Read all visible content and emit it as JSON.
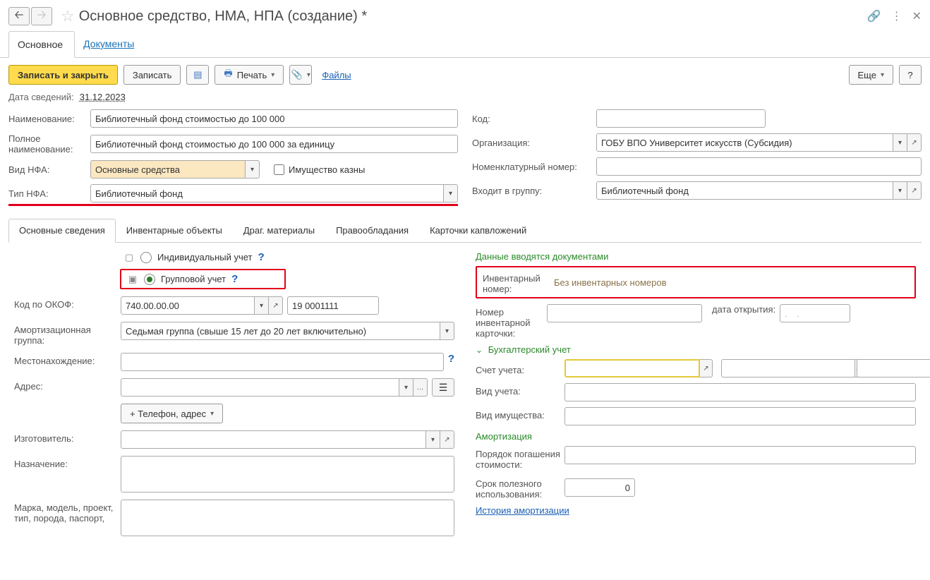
{
  "header": {
    "title": "Основное средство, НМА, НПА (создание) *"
  },
  "main_tabs": [
    {
      "label": "Основное"
    },
    {
      "label": "Документы"
    }
  ],
  "toolbar": {
    "save_close": "Записать и закрыть",
    "save": "Записать",
    "print": "Печать",
    "files": "Файлы",
    "more": "Еще",
    "help": "?"
  },
  "date_row": {
    "label": "Дата сведений:",
    "value": "31.12.2023"
  },
  "fields_left": {
    "name_label": "Наименование:",
    "name_value": "Библиотечный фонд стоимостью до 100 000",
    "fullname_label": "Полное наименование:",
    "fullname_value": "Библиотечный фонд стоимостью до 100 000 за единицу",
    "vid_nfa_label": "Вид НФА:",
    "vid_nfa_value": "Основные средства",
    "treasury_label": "Имущество казны",
    "tip_nfa_label": "Тип НФА:",
    "tip_nfa_value": "Библиотечный фонд"
  },
  "fields_right": {
    "code_label": "Код:",
    "code_value": "",
    "org_label": "Организация:",
    "org_value": "ГОБУ ВПО Университет искусств (Субсидия)",
    "nomen_label": "Номенклатурный номер:",
    "nomen_value": "",
    "group_label": "Входит в группу:",
    "group_value": "Библиотечный фонд"
  },
  "inner_tabs": [
    "Основные сведения",
    "Инвентарные объекты",
    "Драг. материалы",
    "Правообладания",
    "Карточки капвложений"
  ],
  "accounting": {
    "individual": "Индивидуальный учет",
    "group": "Групповой учет"
  },
  "left_inner": {
    "okof_label": "Код по ОКОФ:",
    "okof_value": "740.00.00.00",
    "okof_num": "19 0001111",
    "amort_group_label": "Амортизационная группа:",
    "amort_group_value": "Седьмая группа (свыше 15 лет до 20 лет включительно)",
    "location_label": "Местонахождение:",
    "address_label": "Адрес:",
    "phone_btn": "+ Телефон, адрес",
    "manufacturer_label": "Изготовитель:",
    "purpose_label": "Назначение:",
    "model_label": "Марка, модель, проект,\nтип, порода, паспорт,"
  },
  "right_inner": {
    "docs_title": "Данные вводятся документами",
    "inv_num_label": "Инвентарный номер:",
    "inv_num_value": "Без инвентарных номеров",
    "card_num_label": "Номер инвентарной карточки:",
    "open_date_label": "дата открытия:",
    "open_date_value": ".  .",
    "buh_title": "Бухгалтерский учет",
    "account_label": "Счет учета:",
    "type_account_label": "Вид учета:",
    "property_type_label": "Вид имущества:",
    "amort_title": "Амортизация",
    "repay_label": "Порядок погашения стоимости:",
    "useful_life_label": "Срок полезного использования:",
    "useful_life_value": "0",
    "amort_history": "История амортизации"
  }
}
